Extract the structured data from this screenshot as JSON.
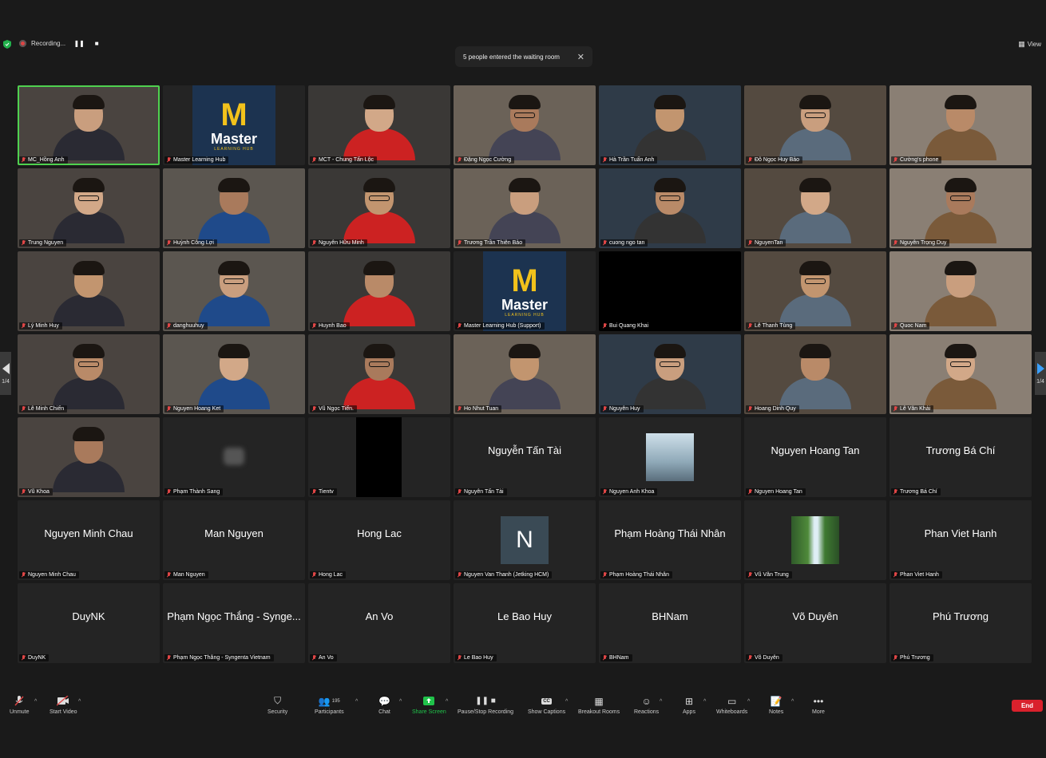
{
  "recording": {
    "label": "Recording..."
  },
  "toast": {
    "text": "5 people entered the waiting room"
  },
  "view": {
    "label": "View"
  },
  "pager": {
    "left": "1/4",
    "right": "1/4"
  },
  "participants": [
    {
      "name": "MC_Hồng Anh",
      "kind": "video",
      "active": true
    },
    {
      "name": "Master Learning Hub",
      "kind": "logo"
    },
    {
      "name": "MCT - Chung Tấn Lộc",
      "kind": "video"
    },
    {
      "name": "Đặng Ngọc Cường",
      "kind": "video"
    },
    {
      "name": "Hà Trần Tuấn Anh",
      "kind": "video"
    },
    {
      "name": "Đỗ Ngọc Huy Bảo",
      "kind": "video"
    },
    {
      "name": "Cường's phone",
      "kind": "video"
    },
    {
      "name": "Trung Nguyen",
      "kind": "video"
    },
    {
      "name": "Huỳnh Công Lợi",
      "kind": "video"
    },
    {
      "name": "Nguyễn Hữu Minh",
      "kind": "video"
    },
    {
      "name": "Trương Trần Thiên Bảo",
      "kind": "video"
    },
    {
      "name": "cuong ngo tan",
      "kind": "video"
    },
    {
      "name": "NguyenTan",
      "kind": "video"
    },
    {
      "name": "Nguyễn Trọng Duy",
      "kind": "video"
    },
    {
      "name": "Lý Minh Huy",
      "kind": "video"
    },
    {
      "name": "danghuuhuy",
      "kind": "video"
    },
    {
      "name": "Huynh Bao",
      "kind": "video"
    },
    {
      "name": "Master Learning Hub (Support)",
      "kind": "logo"
    },
    {
      "name": "Bui Quang Khai",
      "kind": "dark"
    },
    {
      "name": "Lê Thanh Tùng",
      "kind": "video"
    },
    {
      "name": "Quoc Nam",
      "kind": "video"
    },
    {
      "name": "Lê Minh Chiến",
      "kind": "video"
    },
    {
      "name": "Nguyen Hoang Ket",
      "kind": "video"
    },
    {
      "name": "Vũ Ngọc Tiến.",
      "kind": "video"
    },
    {
      "name": "Ho Nhut Tuan",
      "kind": "video"
    },
    {
      "name": "Nguyễn Huy",
      "kind": "video"
    },
    {
      "name": "Hoang Dinh Quy",
      "kind": "video"
    },
    {
      "name": "Lê Văn Khải",
      "kind": "video"
    },
    {
      "name": "Vũ Khoa",
      "kind": "video"
    },
    {
      "name": "Phạm Thành Sang",
      "kind": "blur"
    },
    {
      "name": "Tientv",
      "kind": "blackbox"
    },
    {
      "name": "Nguyễn Tấn Tài",
      "kind": "name",
      "display": "Nguyễn Tấn Tài"
    },
    {
      "name": "Nguyen Anh Khoa",
      "kind": "photo"
    },
    {
      "name": "Nguyen Hoang Tan",
      "kind": "name",
      "display": "Nguyen Hoang Tan"
    },
    {
      "name": "Trương Bá Chí",
      "kind": "name",
      "display": "Trương Bá Chí"
    },
    {
      "name": "Nguyen Minh Chau",
      "kind": "name",
      "display": "Nguyen Minh Chau"
    },
    {
      "name": "Man Nguyen",
      "kind": "name",
      "display": "Man Nguyen"
    },
    {
      "name": "Hong Lac",
      "kind": "name",
      "display": "Hong Lac"
    },
    {
      "name": "Nguyen Van Thanh (Jetking HCM)",
      "kind": "letter",
      "display": "N"
    },
    {
      "name": "Phạm Hoàng Thái Nhân",
      "kind": "name",
      "display": "Phạm Hoàng Thái Nhân"
    },
    {
      "name": "Vũ Văn Trung",
      "kind": "waterfall"
    },
    {
      "name": "Phan Viet Hanh",
      "kind": "name",
      "display": "Phan Viet Hanh"
    },
    {
      "name": "DuyNK",
      "kind": "name",
      "display": "DuyNK"
    },
    {
      "name": "Phạm Ngọc Thắng - Syngenta Vietnam",
      "kind": "name",
      "display": "Phạm Ngọc Thắng - Synge..."
    },
    {
      "name": "An Vo",
      "kind": "name",
      "display": "An Vo"
    },
    {
      "name": "Le Bao Huy",
      "kind": "name",
      "display": "Le Bao Huy"
    },
    {
      "name": "BHNam",
      "kind": "name",
      "display": "BHNam"
    },
    {
      "name": "Võ Duyên",
      "kind": "name",
      "display": "Võ Duyên"
    },
    {
      "name": "Phú Trương",
      "kind": "name",
      "display": "Phú Trương"
    }
  ],
  "logo": {
    "letter": "M",
    "word": "Master",
    "sub": "LEARNING HUB"
  },
  "toolbar": {
    "unmute": "Unmute",
    "start_video": "Start Video",
    "security": "Security",
    "participants": "Participants",
    "participants_count": "195",
    "chat": "Chat",
    "share_screen": "Share Screen",
    "pause_stop": "Pause/Stop Recording",
    "captions": "Show Captions",
    "breakout": "Breakout Rooms",
    "reactions": "Reactions",
    "apps": "Apps",
    "whiteboards": "Whiteboards",
    "notes": "Notes",
    "more": "More",
    "end": "End",
    "cc_badge": "CC"
  },
  "colors": {
    "active_border": "#4fd14f",
    "end": "#d9212c",
    "share": "#20c24a",
    "mic_off": "#e04646"
  }
}
